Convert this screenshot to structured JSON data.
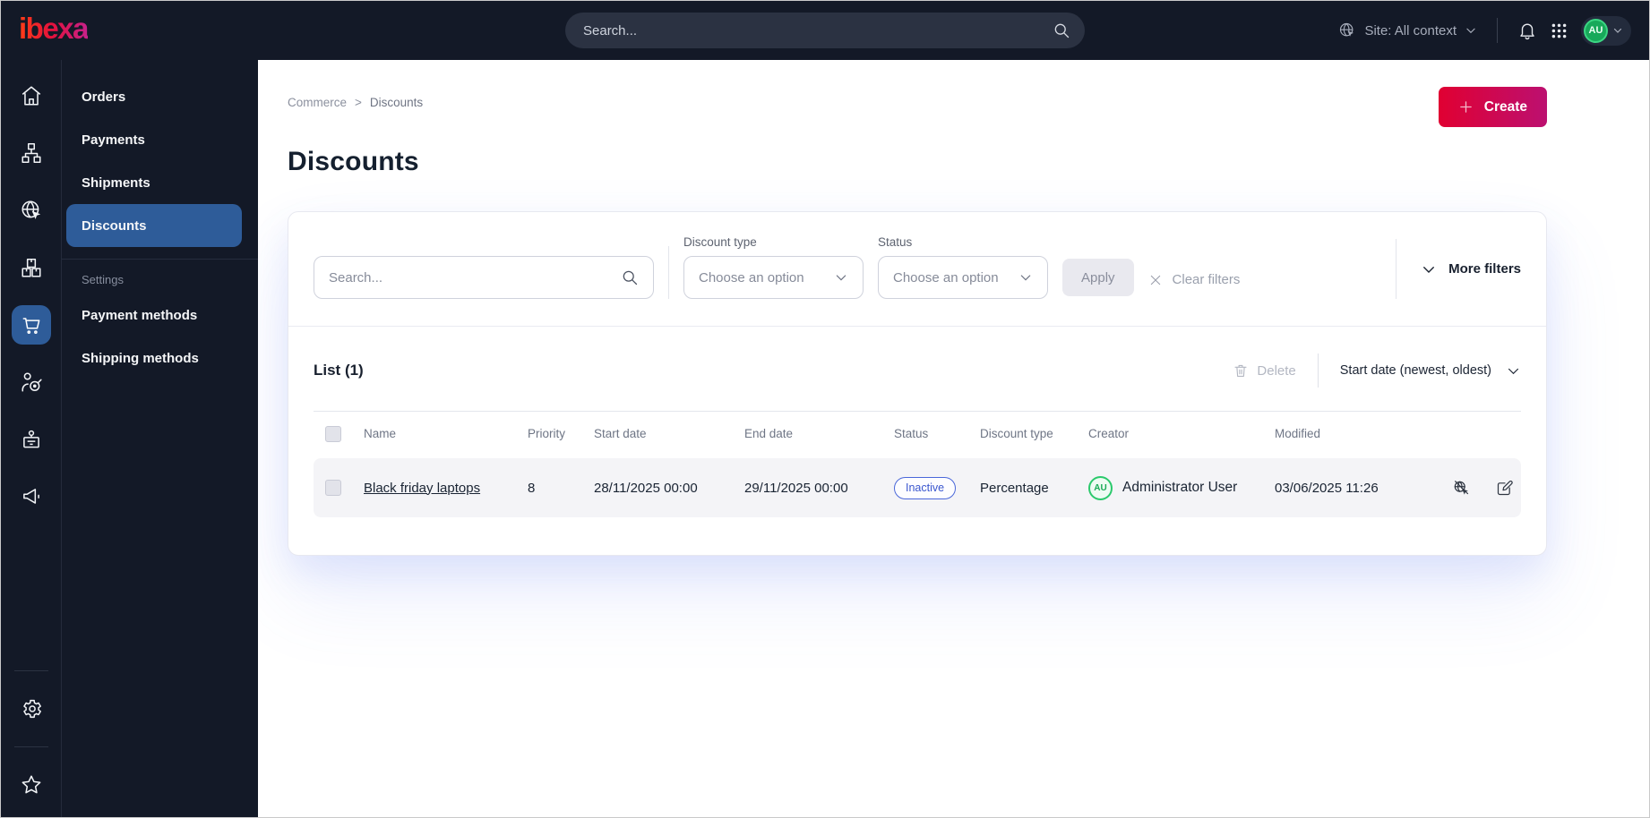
{
  "topbar": {
    "logo": "ibexa",
    "search_placeholder": "Search...",
    "site_context": "Site: All context",
    "user_initials": "AU"
  },
  "rail": {
    "items": [
      "dashboard",
      "content-structure",
      "site",
      "product-catalog",
      "commerce",
      "customers",
      "corporate",
      "marketing"
    ],
    "active_item": "commerce",
    "footer_items": [
      "settings",
      "bookmarks"
    ]
  },
  "sidebar": {
    "items": [
      {
        "label": "Orders",
        "active": false
      },
      {
        "label": "Payments",
        "active": false
      },
      {
        "label": "Shipments",
        "active": false
      },
      {
        "label": "Discounts",
        "active": true
      }
    ],
    "settings_label": "Settings",
    "settings_items": [
      {
        "label": "Payment methods"
      },
      {
        "label": "Shipping methods"
      }
    ]
  },
  "breadcrumb": {
    "items": [
      "Commerce",
      "Discounts"
    ],
    "separator": ">"
  },
  "page": {
    "title": "Discounts",
    "create_label": "Create"
  },
  "filters": {
    "search_placeholder": "Search...",
    "discount_type_label": "Discount type",
    "discount_type_value": "Choose an option",
    "status_label": "Status",
    "status_value": "Choose an option",
    "apply_label": "Apply",
    "clear_label": "Clear filters",
    "more_label": "More filters"
  },
  "list": {
    "title": "List (1)",
    "delete_label": "Delete",
    "sort_label": "Start date (newest, oldest)",
    "columns": [
      "Name",
      "Priority",
      "Start date",
      "End date",
      "Status",
      "Discount type",
      "Creator",
      "Modified"
    ],
    "rows": [
      {
        "name": "Black friday laptops",
        "priority": "8",
        "start_date": "28/11/2025 00:00",
        "end_date": "29/11/2025 00:00",
        "status": "Inactive",
        "discount_type": "Percentage",
        "creator_initials": "AU",
        "creator": "Administrator User",
        "modified": "03/06/2025 11:26"
      }
    ]
  },
  "icons": {
    "topbar": [
      "search-icon",
      "globe-cursor-icon",
      "chevron-down-icon",
      "bell-icon",
      "app-grid-icon"
    ],
    "rail": [
      "home-icon",
      "sitemap-icon",
      "globe-cursor-icon",
      "boxes-icon",
      "cart-icon",
      "customer-target-icon",
      "id-badge-icon",
      "megaphone-icon",
      "gear-icon",
      "star-icon"
    ],
    "list": [
      "trash-icon",
      "checkbox",
      "preview-disabled-icon",
      "edit-icon"
    ]
  },
  "colors": {
    "topbar_bg": "#131927",
    "active_blue": "#2e5c99",
    "brand_gradient_start": "#e00032",
    "brand_gradient_end": "#bc1070",
    "badge_blue": "#4a67d9",
    "avatar_green": "#2bc96c",
    "row_bg": "#f4f4f7"
  }
}
